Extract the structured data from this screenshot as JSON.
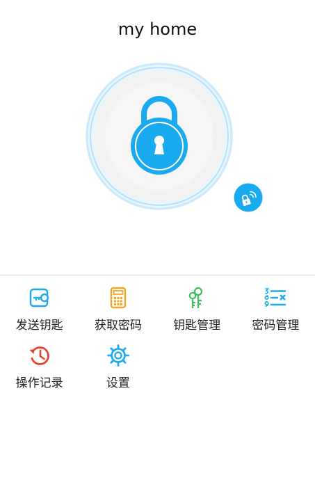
{
  "header": {
    "title": "my home"
  },
  "lock": {
    "icon": "padlock-icon",
    "nfc_icon": "nfc-unlock-icon"
  },
  "menu": {
    "items": [
      {
        "label": "发送钥匙",
        "icon": "send-key-icon"
      },
      {
        "label": "获取密码",
        "icon": "get-password-icon"
      },
      {
        "label": "钥匙管理",
        "icon": "key-management-icon"
      },
      {
        "label": "密码管理",
        "icon": "password-management-icon"
      },
      {
        "label": "操作记录",
        "icon": "history-icon"
      },
      {
        "label": "设置",
        "icon": "settings-icon"
      }
    ]
  },
  "colors": {
    "accent": "#1aaaf0",
    "ring": "#d4eefb",
    "send_key": "#1aaaf0",
    "get_password": "#f5a623",
    "key_management": "#3dbf5c",
    "password_management": "#1aaaf0",
    "history": "#e8432a",
    "settings": "#1aaaf0"
  }
}
